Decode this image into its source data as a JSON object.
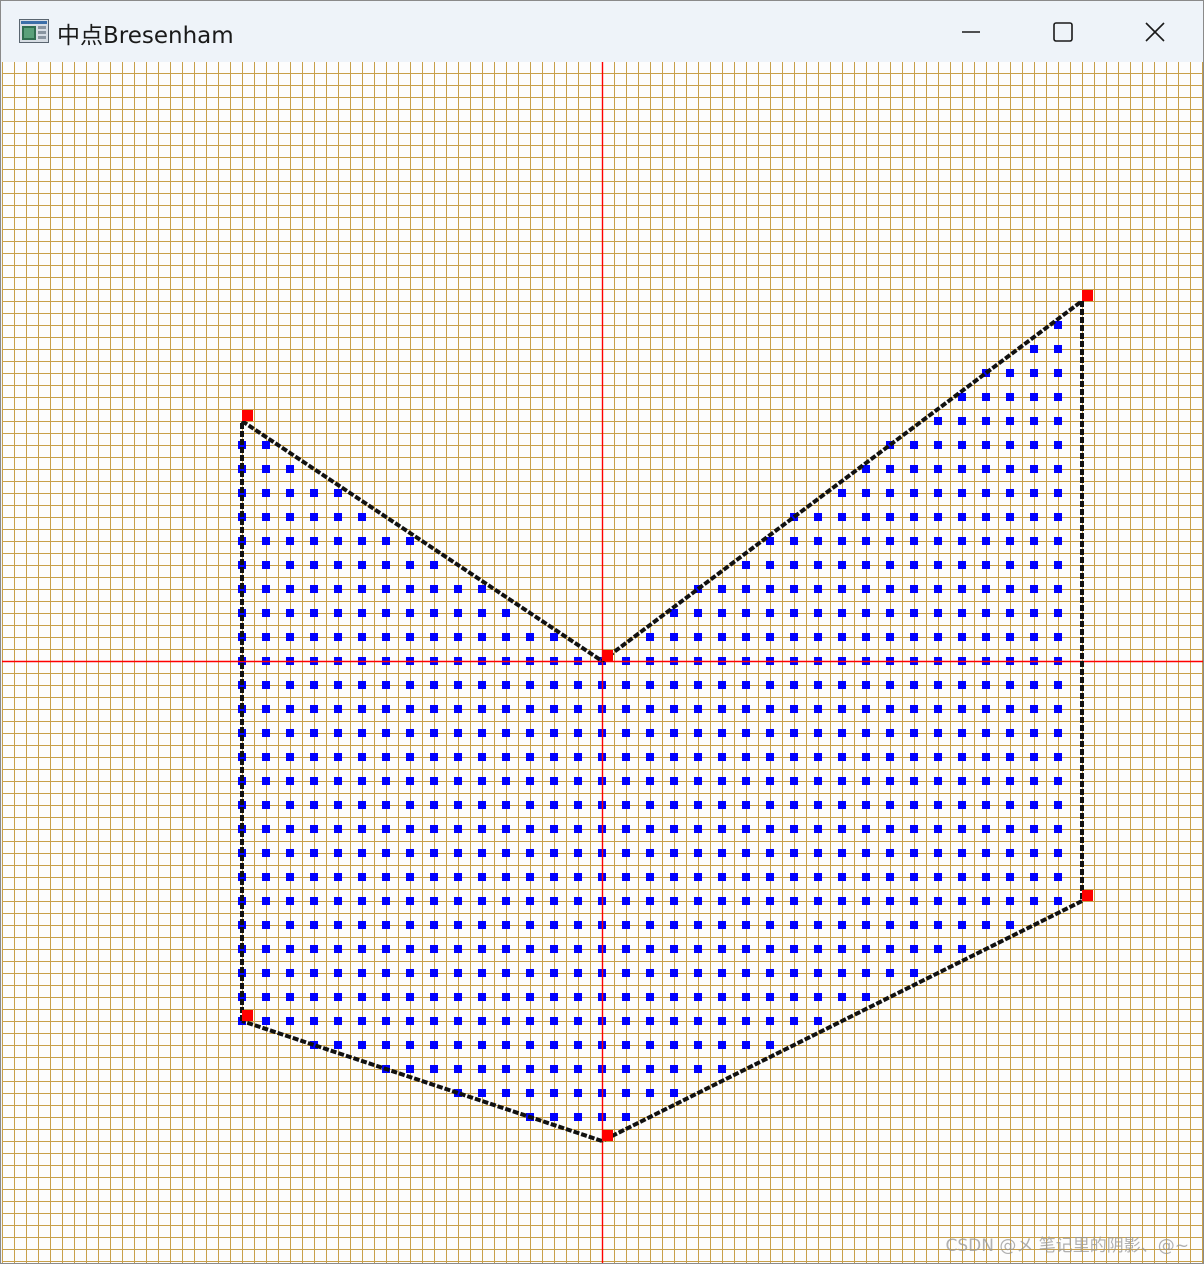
{
  "window": {
    "title": "中点Bresenham",
    "icon": "app-window-icon",
    "controls": {
      "minimize": "minimize-icon",
      "maximize": "maximize-icon",
      "close": "close-icon"
    }
  },
  "colors": {
    "grid": "#c8a04a",
    "axes": "#ff0000",
    "edge": "#111111",
    "fill": "#0000ff",
    "vertex": "#ff0000"
  },
  "canvas": {
    "grid_cell_units": 1,
    "polygon_vertices": [
      {
        "x": -30,
        "y": 20
      },
      {
        "x": 0,
        "y": 0
      },
      {
        "x": 40,
        "y": 30
      },
      {
        "x": 40,
        "y": -20
      },
      {
        "x": 0,
        "y": -40
      },
      {
        "x": -30,
        "y": -30
      }
    ],
    "fill_spacing": 2
  },
  "watermark": "CSDN @メ 笔记里的阴影、@~"
}
